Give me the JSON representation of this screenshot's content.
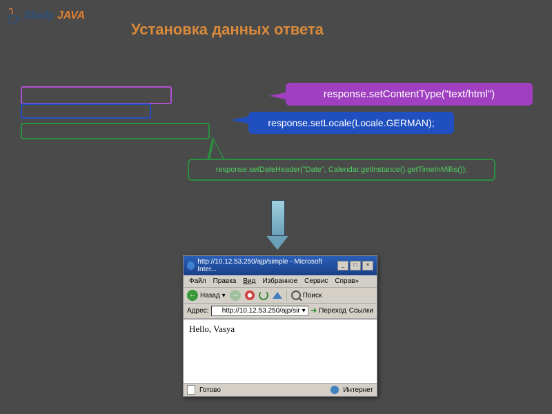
{
  "logo": {
    "study": "Study",
    "java": "JAVA"
  },
  "title": "Установка данных ответа",
  "callouts": {
    "purple": "response.setContentType(\"text/html\")",
    "blue": "response.setLocale(Locale.GERMAN);",
    "green": "response.setDateHeader(\"Date\", Calendar.getInstance().getTimeInMillis());"
  },
  "browser": {
    "title": "http://10.12.53.250/ajp/simple - Microsoft Inter...",
    "menu": {
      "file": "Файл",
      "edit": "Правка",
      "view": "Вид",
      "favorites": "Избранное",
      "tools": "Сервис",
      "help": "Справ»"
    },
    "toolbar": {
      "back": "Назад",
      "search": "Поиск"
    },
    "address": {
      "label": "Адрес:",
      "url": "http://10.12.53.250/ajp/sir",
      "go": "Переход",
      "links": "Ссылки"
    },
    "content": "Hello, Vasya",
    "status": {
      "ready": "Готово",
      "zone": "Интернет"
    }
  }
}
